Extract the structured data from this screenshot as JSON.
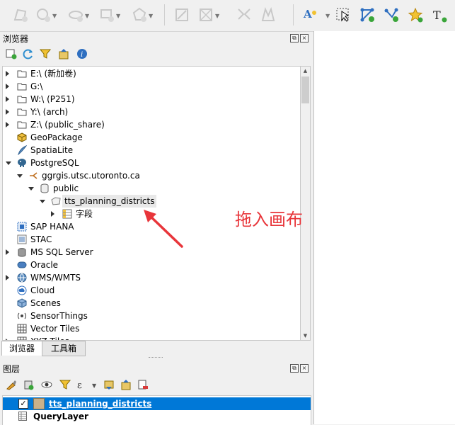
{
  "browser_panel": {
    "title": "浏览器",
    "items": [
      {
        "label": "E:\\ (新加卷)",
        "icon": "folder-icon",
        "arrow": "right",
        "indent": 0
      },
      {
        "label": "G:\\",
        "icon": "folder-icon",
        "arrow": "right",
        "indent": 0
      },
      {
        "label": "W:\\ (P251)",
        "icon": "folder-icon",
        "arrow": "right",
        "indent": 0
      },
      {
        "label": "Y:\\ (arch)",
        "icon": "folder-icon",
        "arrow": "right",
        "indent": 0
      },
      {
        "label": "Z:\\ (public_share)",
        "icon": "folder-icon",
        "arrow": "right",
        "indent": 0
      },
      {
        "label": "GeoPackage",
        "icon": "geopackage-icon",
        "arrow": "none",
        "indent": 0
      },
      {
        "label": "SpatiaLite",
        "icon": "spatialite-icon",
        "arrow": "none",
        "indent": 0
      },
      {
        "label": "PostgreSQL",
        "icon": "postgresql-icon",
        "arrow": "down",
        "indent": 0
      },
      {
        "label": "ggrgis.utsc.utoronto.ca",
        "icon": "connection-icon",
        "arrow": "down",
        "indent": 1
      },
      {
        "label": "public",
        "icon": "schema-icon",
        "arrow": "down",
        "indent": 2
      },
      {
        "label": "tts_planning_districts",
        "icon": "polygon-layer-icon",
        "arrow": "down",
        "indent": 3,
        "selected": true
      },
      {
        "label": "字段",
        "icon": "fields-icon",
        "arrow": "right",
        "indent": 4
      },
      {
        "label": "SAP HANA",
        "icon": "sap-hana-icon",
        "arrow": "none",
        "indent": 0
      },
      {
        "label": "STAC",
        "icon": "stac-icon",
        "arrow": "none",
        "indent": 0
      },
      {
        "label": "MS SQL Server",
        "icon": "mssql-icon",
        "arrow": "right",
        "indent": 0
      },
      {
        "label": "Oracle",
        "icon": "oracle-icon",
        "arrow": "none",
        "indent": 0
      },
      {
        "label": "WMS/WMTS",
        "icon": "wms-icon",
        "arrow": "right",
        "indent": 0
      },
      {
        "label": "Cloud",
        "icon": "cloud-icon",
        "arrow": "none",
        "indent": 0
      },
      {
        "label": "Scenes",
        "icon": "scenes-icon",
        "arrow": "none",
        "indent": 0
      },
      {
        "label": "SensorThings",
        "icon": "sensorthings-icon",
        "arrow": "none",
        "indent": 0
      },
      {
        "label": "Vector Tiles",
        "icon": "vector-tiles-icon",
        "arrow": "none",
        "indent": 0
      },
      {
        "label": "XYZ Tiles",
        "icon": "xyz-tiles-icon",
        "arrow": "right",
        "indent": 0
      }
    ]
  },
  "tabs": [
    {
      "label": "浏览器",
      "active": true
    },
    {
      "label": "工具箱",
      "active": false
    }
  ],
  "layers_panel": {
    "title": "图层",
    "layers": [
      {
        "label": "tts_planning_districts",
        "checked": true,
        "selected": true
      },
      {
        "label": "QueryLayer",
        "checked": false,
        "selected": false
      }
    ]
  },
  "annotation": {
    "text": "拖入画布",
    "color": "#e8353a"
  },
  "colors": {
    "selection": "#0078d7",
    "folder": "#e8c766",
    "accent_blue": "#2f6fc0"
  }
}
